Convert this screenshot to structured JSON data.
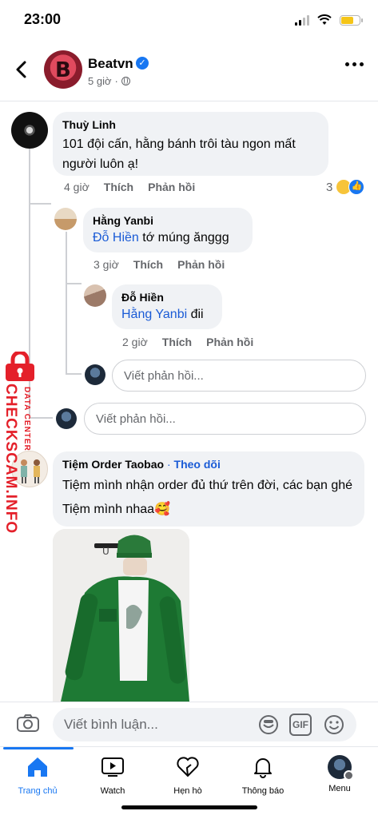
{
  "status": {
    "time": "23:00"
  },
  "header": {
    "page_name": "Beatvn",
    "time_ago": "5 giờ"
  },
  "comments": {
    "c1": {
      "author": "Thuỳ Linh",
      "text": "101 đội cấn, hằng bánh trôi tàu ngon mất người luôn ạ!",
      "time": "4 giờ",
      "like": "Thích",
      "reply": "Phản hồi",
      "reactions": "3"
    },
    "c2": {
      "author": "Hằng Yanbi",
      "mention": "Đỗ Hiền",
      "text": " tớ múng ănggg",
      "time": "3 giờ",
      "like": "Thích",
      "reply": "Phản hồi"
    },
    "c3": {
      "author": "Đỗ Hiền",
      "mention": "Hằng Yanbi",
      "text": " đii",
      "time": "2 giờ",
      "like": "Thích",
      "reply": "Phản hồi"
    },
    "reply_placeholder": "Viết phản hồi...",
    "reply_placeholder_2": "Viết phản hồi...",
    "c4": {
      "author": "Tiệm Order Taobao",
      "follow_sep": " · ",
      "follow": "Theo dõi",
      "text": "Tiệm mình nhận order đủ thứ trên đời, các bạn ghé Tiệm mình nhaa🥰"
    }
  },
  "watermark": {
    "brand": "CHECKSCAM.INFO",
    "sub": "DATA CENTER"
  },
  "composer": {
    "placeholder": "Viết bình luận...",
    "gif": "GIF"
  },
  "tabs": [
    {
      "label": "Trang chủ"
    },
    {
      "label": "Watch"
    },
    {
      "label": "Hẹn hò"
    },
    {
      "label": "Thông báo"
    },
    {
      "label": "Menu"
    }
  ],
  "colors": {
    "accent": "#1877f2",
    "mention": "#1a5bd6",
    "watermark": "#e4202a"
  },
  "icons": [
    "back-arrow-icon",
    "verified-icon",
    "globe-icon",
    "more-icon",
    "camera-icon",
    "sticker-icon",
    "gif-icon",
    "emoji-icon",
    "home-icon",
    "watch-icon",
    "dating-icon",
    "bell-icon",
    "menu-avatar-icon"
  ]
}
